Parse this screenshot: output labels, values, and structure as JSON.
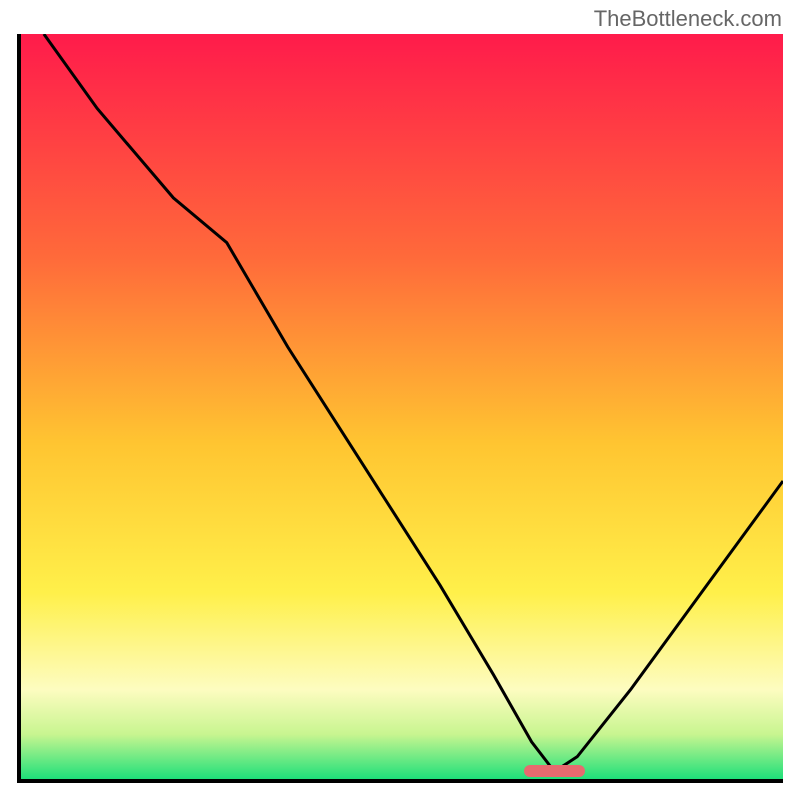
{
  "watermark": "TheBottleneck.com",
  "colors": {
    "top": "#ff1b4b",
    "mid_upper": "#ff7a3a",
    "mid": "#ffd531",
    "mid_lower": "#fff79a",
    "bottom": "#1ee07a",
    "curve": "#000000",
    "marker": "#e76a6f",
    "axis": "#000000"
  },
  "chart_data": {
    "type": "line",
    "title": "",
    "xlabel": "",
    "ylabel": "",
    "xlim": [
      0,
      100
    ],
    "ylim": [
      0,
      100
    ],
    "x": [
      3,
      10,
      20,
      27,
      35,
      45,
      55,
      62,
      67,
      70,
      73,
      80,
      90,
      100
    ],
    "values": [
      100,
      90,
      78,
      72,
      58,
      42,
      26,
      14,
      5,
      1,
      3,
      12,
      26,
      40
    ],
    "optimum_x_range": [
      66,
      74
    ],
    "gradient_stops": [
      {
        "pos": 0,
        "color": "#ff1b4b"
      },
      {
        "pos": 30,
        "color": "#ff6a3a"
      },
      {
        "pos": 55,
        "color": "#ffc531"
      },
      {
        "pos": 75,
        "color": "#fff04a"
      },
      {
        "pos": 88,
        "color": "#fdfcc0"
      },
      {
        "pos": 94,
        "color": "#c8f590"
      },
      {
        "pos": 100,
        "color": "#1ee07a"
      }
    ]
  }
}
